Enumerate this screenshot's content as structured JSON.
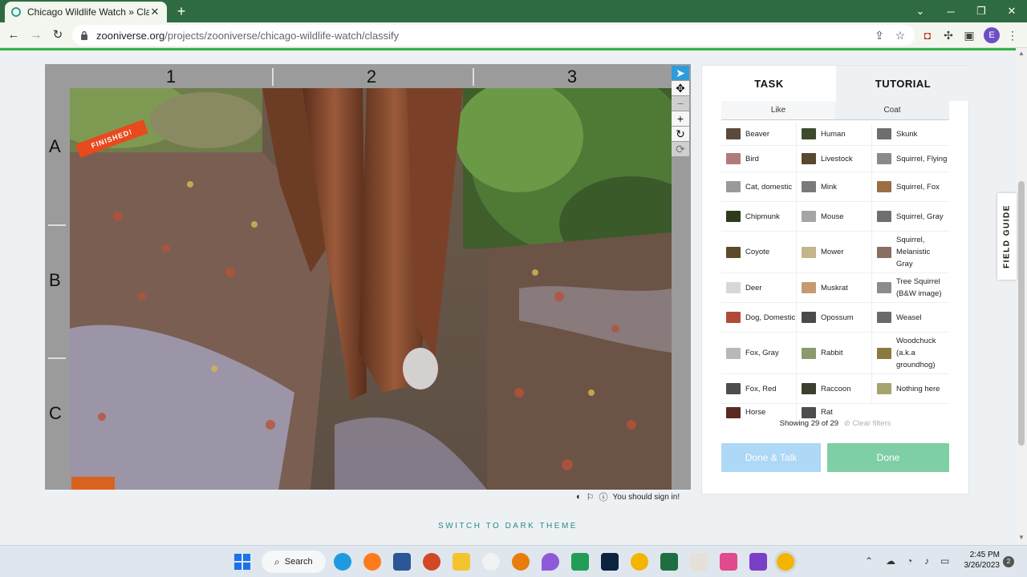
{
  "browser": {
    "tab_title": "Chicago Wildlife Watch » Classify",
    "tab_close": "✕",
    "new_tab": "+",
    "url_domain": "zooniverse.org",
    "url_path": "/projects/zooniverse/chicago-wildlife-watch/classify",
    "profile_initial": "E"
  },
  "viewer": {
    "ribbon": "FINISHED!",
    "columns": [
      "1",
      "2",
      "3"
    ],
    "rows": [
      "A",
      "B",
      "C"
    ],
    "sign_in_message": "You should sign in!"
  },
  "panel": {
    "tabs": [
      "TASK",
      "TUTORIAL"
    ],
    "filters": [
      "Like",
      "Coat"
    ],
    "species_rows": [
      [
        {
          "name": "Beaver",
          "color": "#5a4a3c"
        },
        {
          "name": "Human",
          "color": "#3d4a2d"
        },
        {
          "name": "Skunk",
          "color": "#6e6e6e"
        }
      ],
      [
        {
          "name": "Bird",
          "color": "#b27b7b"
        },
        {
          "name": "Livestock",
          "color": "#5b4630"
        },
        {
          "name": "Squirrel, Flying",
          "color": "#8a8a8a"
        }
      ],
      [
        {
          "name": "Cat, domestic",
          "color": "#9a9a9a"
        },
        {
          "name": "Mink",
          "color": "#7a7a7a"
        },
        {
          "name": "Squirrel, Fox",
          "color": "#9b6e44"
        }
      ],
      [
        {
          "name": "Chipmunk",
          "color": "#2e3a1c"
        },
        {
          "name": "Mouse",
          "color": "#a5a5a5"
        },
        {
          "name": "Squirrel, Gray",
          "color": "#6f6f6f"
        }
      ],
      [
        {
          "name": "Coyote",
          "color": "#5c4a2a"
        },
        {
          "name": "Mower",
          "color": "#c2b68a"
        },
        {
          "name": "Squirrel, Melanistic Gray",
          "color": "#8a6e62"
        }
      ],
      [
        {
          "name": "Deer",
          "color": "#d7d7d7"
        },
        {
          "name": "Muskrat",
          "color": "#c59a72"
        },
        {
          "name": "Tree Squirrel (B&W image)",
          "color": "#8c8c8c"
        }
      ],
      [
        {
          "name": "Dog, Domestic",
          "color": "#b24a3a"
        },
        {
          "name": "Opossum",
          "color": "#4a4a4a"
        },
        {
          "name": "Weasel",
          "color": "#6a6a6a"
        }
      ],
      [
        {
          "name": "Fox, Gray",
          "color": "#b8b8b8"
        },
        {
          "name": "Rabbit",
          "color": "#8b9a6e"
        },
        {
          "name": "Woodchuck (a.k.a groundhog)",
          "color": "#8a7a3e"
        }
      ],
      [
        {
          "name": "Fox, Red",
          "color": "#4e4e4e"
        },
        {
          "name": "Raccoon",
          "color": "#3b3f2e"
        },
        {
          "name": "Nothing here",
          "color": "#a7a36e"
        }
      ],
      [
        {
          "name": "Horse",
          "color": "#5a2a22"
        },
        {
          "name": "Rat",
          "color": "#4d4d4d"
        }
      ]
    ],
    "showing": "Showing 29 of 29",
    "clear_filters": "Clear filters",
    "done_talk": "Done & Talk",
    "done": "Done",
    "field_guide": "FIELD GUIDE"
  },
  "footer": {
    "dark_theme": "SWITCH TO DARK THEME"
  },
  "taskbar": {
    "search": "Search",
    "time": "2:45 PM",
    "date": "3/26/2023",
    "notifications": "2"
  }
}
